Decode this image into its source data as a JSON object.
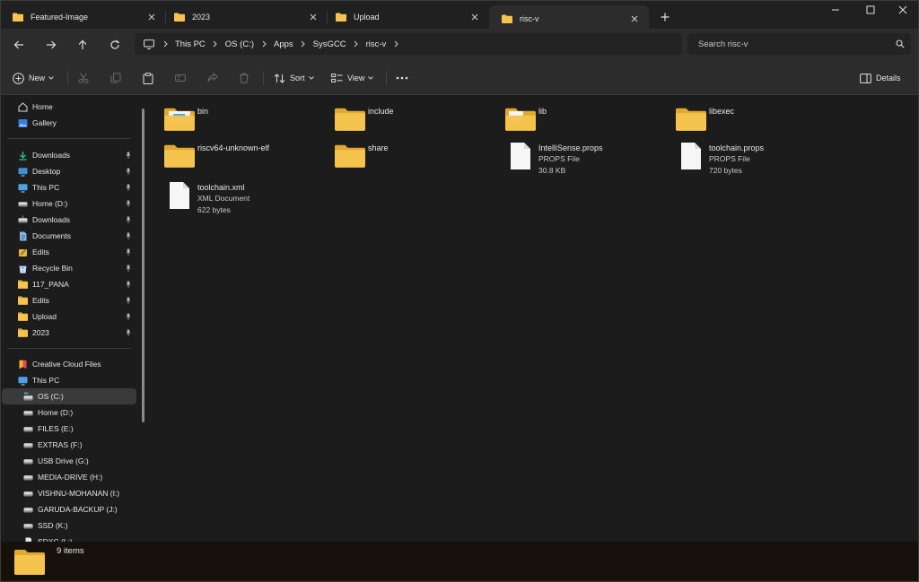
{
  "colors": {
    "folder": "#f5c44e",
    "folder_dark": "#e0a92d",
    "accent": "#4cc2ff",
    "window_bg": "#1c1c1c",
    "toolbar_bg": "#2c2c2c"
  },
  "tabs": [
    {
      "label": "Featured-Image",
      "icon": "folder-icon",
      "active": false
    },
    {
      "label": "2023",
      "icon": "folder-icon",
      "active": false
    },
    {
      "label": "Upload",
      "icon": "folder-icon",
      "active": false
    },
    {
      "label": "risc-v",
      "icon": "folder-icon",
      "active": true
    }
  ],
  "window_controls": [
    "minimize-icon",
    "maximize-icon",
    "close-icon"
  ],
  "nav": {
    "back": "back-arrow-icon",
    "forward": "forward-arrow-icon",
    "up": "up-arrow-icon",
    "refresh": "refresh-icon"
  },
  "breadcrumb": [
    "This PC",
    "OS (C:)",
    "Apps",
    "SysGCC",
    "risc-v"
  ],
  "search": {
    "placeholder": "Search risc-v"
  },
  "commands": {
    "new": "New",
    "sort": "Sort",
    "view": "View",
    "details": "Details",
    "icons": [
      "plus-icon",
      "cut-icon",
      "copy-icon",
      "paste-icon",
      "rename-icon",
      "share-icon",
      "delete-icon",
      "sort-icon",
      "view-icon",
      "more-icon",
      "details-pane-icon"
    ]
  },
  "sidebar": {
    "top": [
      {
        "label": "Home",
        "icon": "home-icon"
      },
      {
        "label": "Gallery",
        "icon": "gallery-icon"
      }
    ],
    "quick_access": [
      {
        "label": "Downloads",
        "icon": "download-icon",
        "pinned": true
      },
      {
        "label": "Desktop",
        "icon": "desktop-icon",
        "pinned": true
      },
      {
        "label": "This PC",
        "icon": "monitor-icon",
        "pinned": true
      },
      {
        "label": "Home (D:)",
        "icon": "drive-icon",
        "pinned": true
      },
      {
        "label": "Downloads",
        "icon": "download-drive-icon",
        "pinned": true
      },
      {
        "label": "Documents",
        "icon": "documents-icon",
        "pinned": true
      },
      {
        "label": "Edits",
        "icon": "edits-icon",
        "pinned": true
      },
      {
        "label": "Recycle Bin",
        "icon": "recycle-bin-icon",
        "pinned": true
      },
      {
        "label": "117_PANA",
        "icon": "folder-icon",
        "pinned": true
      },
      {
        "label": "Edits",
        "icon": "folder-icon",
        "pinned": true
      },
      {
        "label": "Upload",
        "icon": "folder-icon",
        "pinned": true
      },
      {
        "label": "2023",
        "icon": "folder-icon",
        "pinned": true
      }
    ],
    "devices": [
      {
        "label": "Creative Cloud Files",
        "icon": "creative-cloud-icon",
        "indent": 0
      },
      {
        "label": "This PC",
        "icon": "monitor-icon",
        "indent": 0
      },
      {
        "label": "OS (C:)",
        "icon": "windows-drive-icon",
        "indent": 1,
        "selected": true
      },
      {
        "label": "Home (D:)",
        "icon": "drive-icon",
        "indent": 1
      },
      {
        "label": "FILES (E:)",
        "icon": "drive-icon",
        "indent": 1
      },
      {
        "label": "EXTRAS (F:)",
        "icon": "drive-icon",
        "indent": 1
      },
      {
        "label": "USB Drive (G:)",
        "icon": "drive-icon",
        "indent": 1
      },
      {
        "label": "MEDIA-DRIVE (H:)",
        "icon": "drive-icon",
        "indent": 1
      },
      {
        "label": "VISHNU-MOHANAN (I:)",
        "icon": "drive-icon",
        "indent": 1
      },
      {
        "label": "GARUDA-BACKUP (J:)",
        "icon": "drive-icon",
        "indent": 1
      },
      {
        "label": "SSD (K:)",
        "icon": "drive-icon",
        "indent": 1
      },
      {
        "label": "SDXC (L:)",
        "icon": "sd-card-icon",
        "indent": 1
      }
    ]
  },
  "files": [
    {
      "name": "bin",
      "kind": "folder",
      "type": "",
      "size": ""
    },
    {
      "name": "include",
      "kind": "folder",
      "type": "",
      "size": ""
    },
    {
      "name": "lib",
      "kind": "folder",
      "type": "",
      "size": ""
    },
    {
      "name": "libexec",
      "kind": "folder",
      "type": "",
      "size": ""
    },
    {
      "name": "riscv64-unknown-elf",
      "kind": "folder",
      "type": "",
      "size": ""
    },
    {
      "name": "share",
      "kind": "folder",
      "type": "",
      "size": ""
    },
    {
      "name": "IntelliSense.props",
      "kind": "file",
      "type": "PROPS File",
      "size": "30.8 KB"
    },
    {
      "name": "toolchain.props",
      "kind": "file",
      "type": "PROPS File",
      "size": "720 bytes"
    },
    {
      "name": "toolchain.xml",
      "kind": "file",
      "type": "XML Document",
      "size": "622 bytes"
    }
  ],
  "status": {
    "count": "9 items"
  }
}
